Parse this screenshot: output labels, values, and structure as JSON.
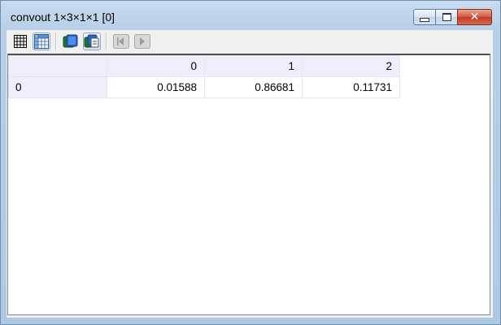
{
  "window": {
    "title": "convout 1×3×1×1 [0]",
    "controls": {
      "minimize": "minimize",
      "maximize": "maximize",
      "close": "close"
    }
  },
  "toolbar": {
    "buttons": [
      {
        "icon": "grid-view-icon",
        "active": false
      },
      {
        "icon": "table-view-icon",
        "active": true
      },
      {
        "icon": "image-single-icon",
        "active": false
      },
      {
        "icon": "image-multi-icon",
        "active": true
      },
      {
        "icon": "previous-icon",
        "active": false,
        "disabled": true
      },
      {
        "icon": "next-icon",
        "active": false,
        "disabled": true
      }
    ]
  },
  "table": {
    "column_headers": [
      "0",
      "1",
      "2"
    ],
    "rows": [
      {
        "header": "0",
        "cells": [
          "0.01588",
          "0.86681",
          "0.11731"
        ]
      }
    ]
  },
  "colors": {
    "header_bg": "#eeeefc",
    "close_button": "#c8472d",
    "title_bar": "#c9dcf0"
  }
}
